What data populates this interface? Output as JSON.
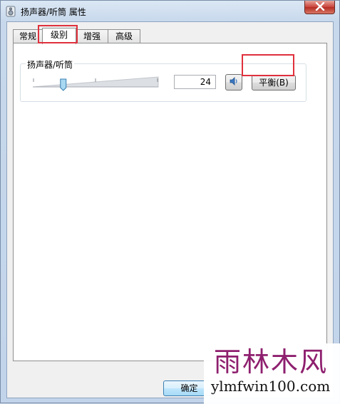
{
  "window": {
    "title": "扬声器/听筒 属性",
    "icon": "speaker-icon"
  },
  "tabs": [
    {
      "label": "常规",
      "active": false
    },
    {
      "label": "级别",
      "active": true
    },
    {
      "label": "增强",
      "active": false
    },
    {
      "label": "高级",
      "active": false
    }
  ],
  "level": {
    "group_label": "扬声器/听筒",
    "value": "24",
    "slider_fraction": 0.24,
    "mute_icon": "speaker-volume-icon",
    "balance_label": "平衡(B)"
  },
  "footer": {
    "ok_label": "确定"
  },
  "watermark": {
    "top": "雨林木风",
    "bottom": "ylmfwin100.com"
  },
  "colors": {
    "highlight": "#e0303c",
    "close": "#c8423a",
    "watermark": "#8e1f6e"
  }
}
